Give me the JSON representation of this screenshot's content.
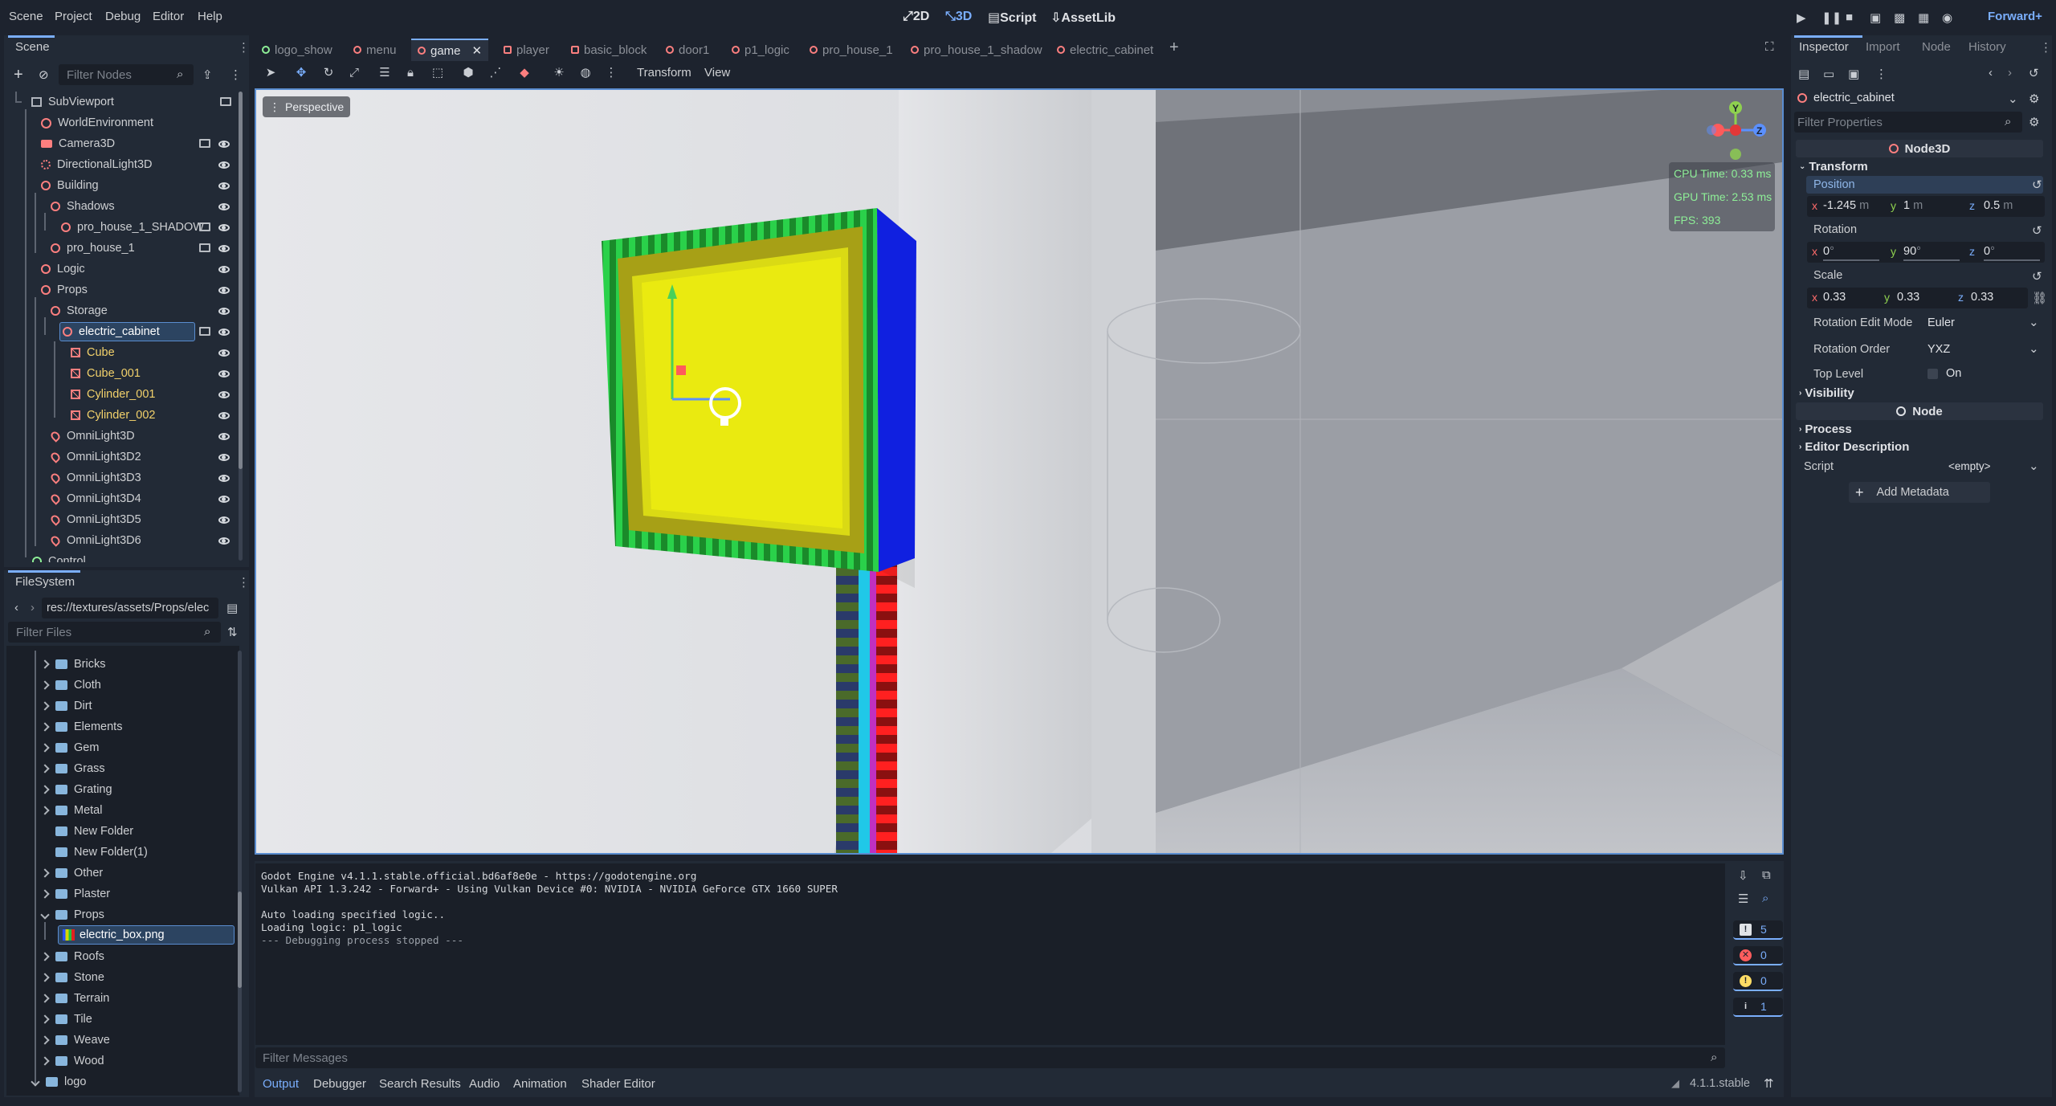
{
  "menubar": {
    "items": [
      "Scene",
      "Project",
      "Debug",
      "Editor",
      "Help"
    ],
    "modes": [
      "2D",
      "3D",
      "Script",
      "AssetLib"
    ],
    "renderer": "Forward+"
  },
  "scene_dock": {
    "tab": "Scene",
    "filter_placeholder": "Filter Nodes",
    "nodes": [
      {
        "label": "SubViewport"
      },
      {
        "label": "WorldEnvironment"
      },
      {
        "label": "Camera3D"
      },
      {
        "label": "DirectionalLight3D"
      },
      {
        "label": "Building"
      },
      {
        "label": "Shadows"
      },
      {
        "label": "pro_house_1_SHADOW"
      },
      {
        "label": "pro_house_1"
      },
      {
        "label": "Logic"
      },
      {
        "label": "Props"
      },
      {
        "label": "Storage"
      },
      {
        "label": "electric_cabinet"
      },
      {
        "label": "Cube"
      },
      {
        "label": "Cube_001"
      },
      {
        "label": "Cylinder_001"
      },
      {
        "label": "Cylinder_002"
      },
      {
        "label": "OmniLight3D"
      },
      {
        "label": "OmniLight3D2"
      },
      {
        "label": "OmniLight3D3"
      },
      {
        "label": "OmniLight3D4"
      },
      {
        "label": "OmniLight3D5"
      },
      {
        "label": "OmniLight3D6"
      },
      {
        "label": "Control"
      }
    ]
  },
  "filesystem": {
    "tab": "FileSystem",
    "path": "res://textures/assets/Props/elec",
    "filter_placeholder": "Filter Files",
    "items": [
      {
        "label": "Bricks"
      },
      {
        "label": "Cloth"
      },
      {
        "label": "Dirt"
      },
      {
        "label": "Elements"
      },
      {
        "label": "Gem"
      },
      {
        "label": "Grass"
      },
      {
        "label": "Grating"
      },
      {
        "label": "Metal"
      },
      {
        "label": "New Folder"
      },
      {
        "label": "New Folder(1)"
      },
      {
        "label": "Other"
      },
      {
        "label": "Plaster"
      },
      {
        "label": "Props"
      },
      {
        "label": "electric_box.png"
      },
      {
        "label": "Roofs"
      },
      {
        "label": "Stone"
      },
      {
        "label": "Terrain"
      },
      {
        "label": "Tile"
      },
      {
        "label": "Weave"
      },
      {
        "label": "Wood"
      },
      {
        "label": "logo"
      }
    ]
  },
  "doc_tabs": [
    "logo_show",
    "menu",
    "game",
    "player",
    "basic_block",
    "door1",
    "p1_logic",
    "pro_house_1",
    "pro_house_1_shadow",
    "electric_cabinet"
  ],
  "viewport": {
    "toolbar": {
      "transform": "Transform",
      "view": "View"
    },
    "perspective_label": "Perspective",
    "stats": {
      "cpu": "CPU Time: 0.33 ms",
      "gpu": "GPU Time: 2.53 ms",
      "fps": "FPS: 393"
    },
    "gizmo_axes": {
      "y": "Y",
      "z": "Z"
    }
  },
  "console": {
    "lines": [
      "Godot Engine v4.1.1.stable.official.bd6af8e0e - https://godotengine.org",
      "Vulkan API 1.3.242 - Forward+ - Using Vulkan Device #0: NVIDIA - NVIDIA GeForce GTX 1660 SUPER",
      "",
      "Auto loading specified logic..",
      "Loading logic: p1_logic",
      "--- Debugging process stopped ---"
    ],
    "filter_placeholder": "Filter Messages",
    "counts": {
      "messages": "5",
      "errors": "0",
      "warnings": "0",
      "info": "1"
    }
  },
  "bottom_tabs": [
    "Output",
    "Debugger",
    "Search Results",
    "Audio",
    "Animation",
    "Shader Editor"
  ],
  "version": "4.1.1.stable",
  "inspector": {
    "tabs": [
      "Inspector",
      "Import",
      "Node",
      "History"
    ],
    "node_name": "electric_cabinet",
    "filter_placeholder": "Filter Properties",
    "class_header": "Node3D",
    "transform_label": "Transform",
    "position_label": "Position",
    "position": {
      "x": "-1.245",
      "y": "1",
      "z": "0.5",
      "unit": "m"
    },
    "rotation_label": "Rotation",
    "rotation": {
      "x": "0",
      "y": "90",
      "z": "0",
      "unit": "°"
    },
    "scale_label": "Scale",
    "scale": {
      "x": "0.33",
      "y": "0.33",
      "z": "0.33"
    },
    "rotation_edit_mode_label": "Rotation Edit Mode",
    "rotation_edit_mode": "Euler",
    "rotation_order_label": "Rotation Order",
    "rotation_order": "YXZ",
    "top_level_label": "Top Level",
    "top_level_value": "On",
    "visibility_label": "Visibility",
    "node_header": "Node",
    "process_label": "Process",
    "editor_description_label": "Editor Description",
    "script_label": "Script",
    "script_value": "<empty>",
    "add_metadata": "Add Metadata"
  },
  "colors": {
    "accent": "#7aaefc",
    "node_icon": "#fc7f7f",
    "bg": "#1d232e",
    "panel": "#222a36"
  }
}
